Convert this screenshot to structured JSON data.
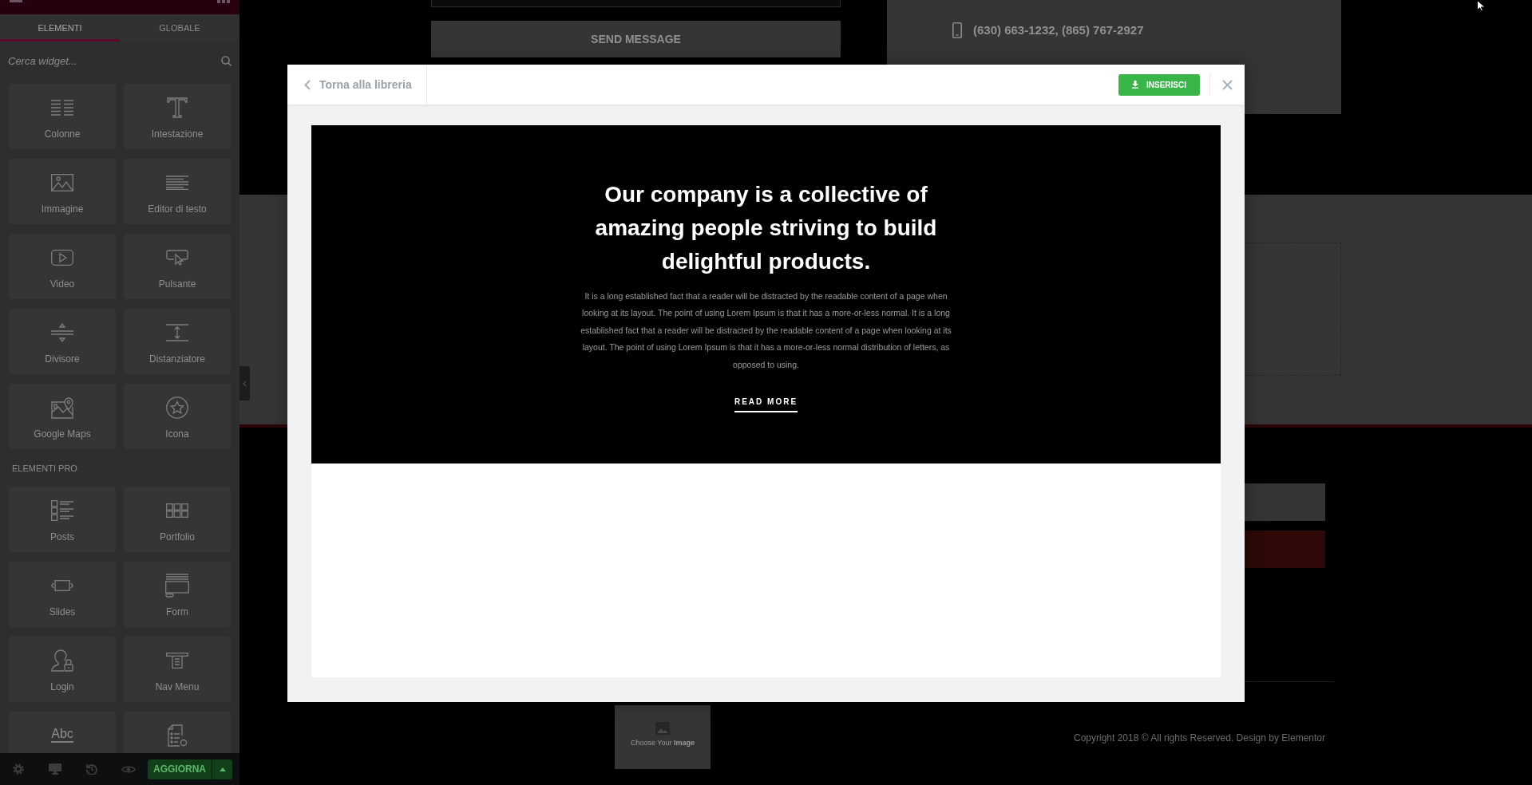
{
  "sidebar": {
    "tabs": [
      {
        "label": "ELEMENTI",
        "selected": true
      },
      {
        "label": "GLOBALE",
        "selected": false
      }
    ],
    "search": {
      "placeholder": "Cerca widget..."
    },
    "sections": [
      {
        "widgets": [
          {
            "label": "Colonne"
          },
          {
            "label": "Intestazione"
          },
          {
            "label": "Immagine"
          },
          {
            "label": "Editor di testo"
          },
          {
            "label": "Video"
          },
          {
            "label": "Pulsante"
          },
          {
            "label": "Divisore"
          },
          {
            "label": "Distanziatore"
          },
          {
            "label": "Google Maps"
          },
          {
            "label": "Icona"
          }
        ]
      },
      {
        "title": "ELEMENTI PRO",
        "widgets": [
          {
            "label": "Posts"
          },
          {
            "label": "Portfolio"
          },
          {
            "label": "Slides"
          },
          {
            "label": "Form"
          },
          {
            "label": "Login"
          },
          {
            "label": "Nav Menu"
          }
        ]
      }
    ],
    "partial_row": {
      "icon_text": "Abc"
    },
    "footer": {
      "update_button": "AGGIORNA"
    }
  },
  "canvas": {
    "send_button": "SEND MESSAGE",
    "phone": "(630) 663-1232, (865) 767-2927",
    "image_placeholder": "Choose Your **Image**",
    "copyright": "Copyright 2018 © All rights Reserved. Design by Elementor"
  },
  "modal": {
    "back_link": "Torna alla libreria",
    "insert_button": "INSERISCI",
    "preview": {
      "heading": "Our company is a collective of amazing people striving to build delightful products.",
      "text": "It is a long established fact that a reader will be distracted by the readable content of a page when looking at its layout. The point of using Lorem Ipsum is that it has a more-or-less normal. It is a long established fact that a reader will be distracted by the readable content of a page when looking at its layout. The point of using Lorem Ipsum is that it has a more-or-less normal distribution of letters, as opposed to using.",
      "link": "READ MORE"
    }
  }
}
